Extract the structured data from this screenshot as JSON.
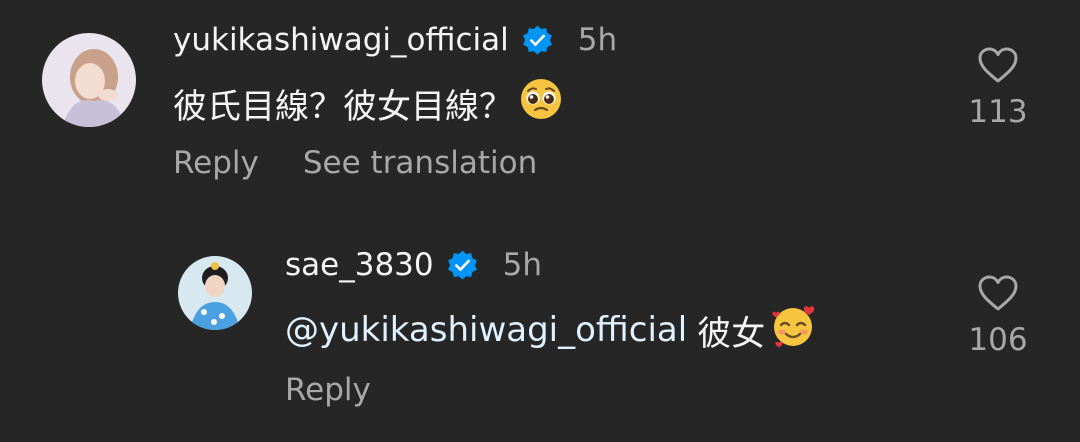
{
  "comments": [
    {
      "username": "yukikashiwagi_official",
      "time": "5h",
      "text": "彼氏目線？彼女目線？",
      "emoji": "pleading-face",
      "reply_label": "Reply",
      "translate_label": "See translation",
      "like_count": "113",
      "verified": true
    },
    {
      "username": "sae_3830",
      "time": "5h",
      "mention": "@yukikashiwagi_official",
      "text": "彼女",
      "emoji": "smiling-face-with-hearts",
      "reply_label": "Reply",
      "like_count": "106",
      "verified": true
    }
  ],
  "colors": {
    "background": "#262626",
    "primary_text": "#f5f5f5",
    "secondary_text": "#a8a8a8",
    "verified_blue": "#0095f6",
    "mention": "#e0f1ff"
  }
}
